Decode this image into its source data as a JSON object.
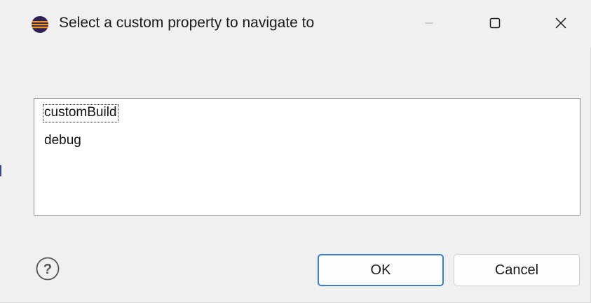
{
  "window": {
    "title": "Select a custom property to navigate to",
    "app_icon": "eclipse-icon",
    "controls": {
      "minimize_icon": "minimize-icon",
      "maximize_icon": "maximize-icon",
      "close_icon": "close-icon"
    }
  },
  "list": {
    "items": [
      {
        "label": "customBuild",
        "selected": true
      },
      {
        "label": "debug",
        "selected": false
      }
    ]
  },
  "footer": {
    "help_icon": "help-icon",
    "ok_label": "OK",
    "cancel_label": "Cancel"
  },
  "colors": {
    "background": "#f0f0f0",
    "accent": "#3b7fc6",
    "list_background": "#ffffff"
  }
}
